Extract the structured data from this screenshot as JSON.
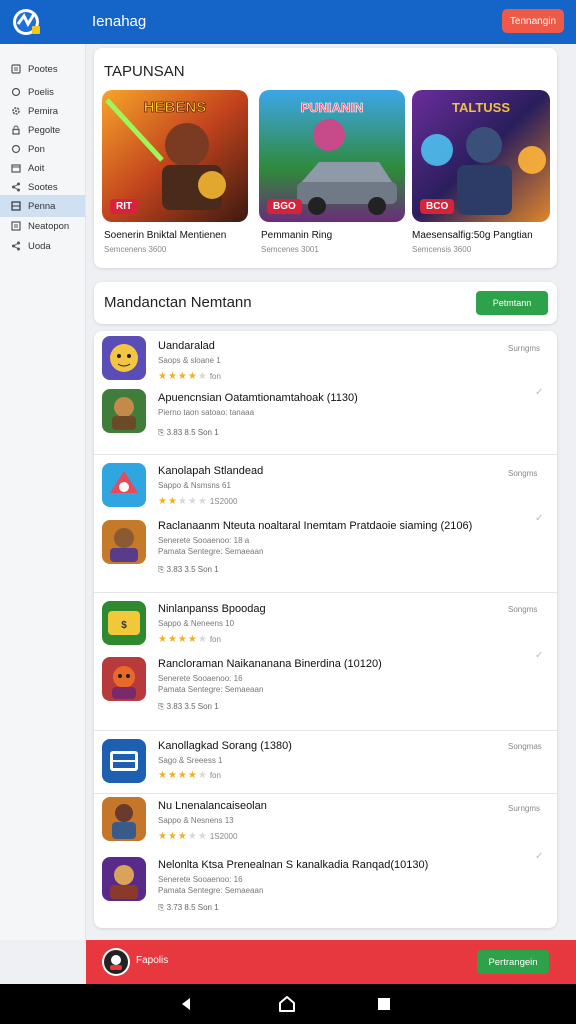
{
  "header": {
    "title": "Ienahag",
    "button_label": "Tennangin"
  },
  "sidebar": {
    "items": [
      {
        "label": "Pootes",
        "icon": "document-icon"
      },
      {
        "label": "Poelis",
        "icon": "circle-icon"
      },
      {
        "label": "Pemira",
        "icon": "gear-icon"
      },
      {
        "label": "Pegolte",
        "icon": "lock-icon"
      },
      {
        "label": "Pon",
        "icon": "circle-icon"
      },
      {
        "label": "Aoit",
        "icon": "calendar-icon"
      },
      {
        "label": "Sootes",
        "icon": "share-icon"
      },
      {
        "label": "Penna",
        "icon": "grid-icon",
        "active": true
      },
      {
        "label": "Neatopon",
        "icon": "list-icon"
      },
      {
        "label": "Uoda",
        "icon": "share-icon"
      }
    ]
  },
  "featured": {
    "title": "TAPUNSAN",
    "tiles": [
      {
        "badge": "RIT",
        "title": "Soenerin Bniktal Mentienen",
        "subtitle": "Semcenens 3600",
        "art_text": "HEBENS"
      },
      {
        "badge": "BGO",
        "title": "Pemmanin Ring",
        "subtitle": "Semcenes 3001",
        "art_text": "PUNIANIN"
      },
      {
        "badge": "BCO",
        "title": "Maesensalfig:50g Pangtian",
        "subtitle": "Semcensis 3600",
        "art_text": "TALTUSS"
      }
    ]
  },
  "list_header": {
    "title": "Mandanctan Nemtann",
    "button_label": "Petmtann"
  },
  "list": [
    {
      "status": "Surngms",
      "items": [
        {
          "title": "Uandaralad",
          "subtitle": "Saops & sloane 1",
          "rating": 4,
          "rating_text": "fon"
        },
        {
          "title": "Apuencnsian Oatamtionamtahoak (1130)",
          "subtitle": "Pierno taon satoao: tanaaa",
          "meta": "3.83 8.5 Son 1"
        }
      ]
    },
    {
      "status": "Songms",
      "items": [
        {
          "title": "Kanolapah Stlandead",
          "subtitle": "Sappo & Nsmsns 61",
          "rating": 2,
          "rating_text": "1S2000"
        },
        {
          "title": "Raclanaanm Nteuta noaltaral Inemtam Pratdaoie siaming (2106)",
          "subtitle": "Senerete Sooaenoo: 18 a",
          "subtitle2": "Pamata Sentegre: Semaeaan",
          "meta": "3.83 3.5 Son 1"
        }
      ]
    },
    {
      "status": "Songms",
      "items": [
        {
          "title": "Ninlanpanss Bpoodag",
          "subtitle": "Sappo & Neneens 10",
          "rating": 4,
          "rating_text": "fon"
        },
        {
          "title": "Rancloraman Naikananana Binerdina (10120)",
          "subtitle": "Senerete Sooaenoo: 16",
          "subtitle2": "Pamata Sentegre: Semaeaan",
          "meta": "3.83 3.5 Son 1"
        }
      ]
    },
    {
      "status": "Songmas",
      "items": [
        {
          "title": "Kanollagkad Sorang (1380)",
          "subtitle": "Sago & Sreeess 1",
          "rating": 4,
          "rating_text": "fon"
        }
      ]
    },
    {
      "status": "Surngms",
      "items": [
        {
          "title": "Nu Lnenalancaiseolan",
          "subtitle": "Sappo & Nesnens 13",
          "rating": 3,
          "rating_text": "1S2000"
        },
        {
          "title": "Nelonlta Ktsa Prenealnan S kanalkadia Ranqad(10130)",
          "subtitle": "Senerete Sooaenoo: 16",
          "subtitle2": "Pamata Sentegre: Semaeaan",
          "meta": "3.73 8.5 Son 1"
        }
      ]
    }
  ],
  "footer": {
    "label": "Fapolis",
    "button_label": "Pertrangein"
  },
  "nav": {
    "back": "◀",
    "home": "home-icon",
    "recent": "recent-icon"
  },
  "colors": {
    "primary": "#1565c9",
    "accent_red": "#ef5a48",
    "green": "#2ea24a",
    "star": "#f2b01e",
    "footer_red": "#e8383f"
  }
}
